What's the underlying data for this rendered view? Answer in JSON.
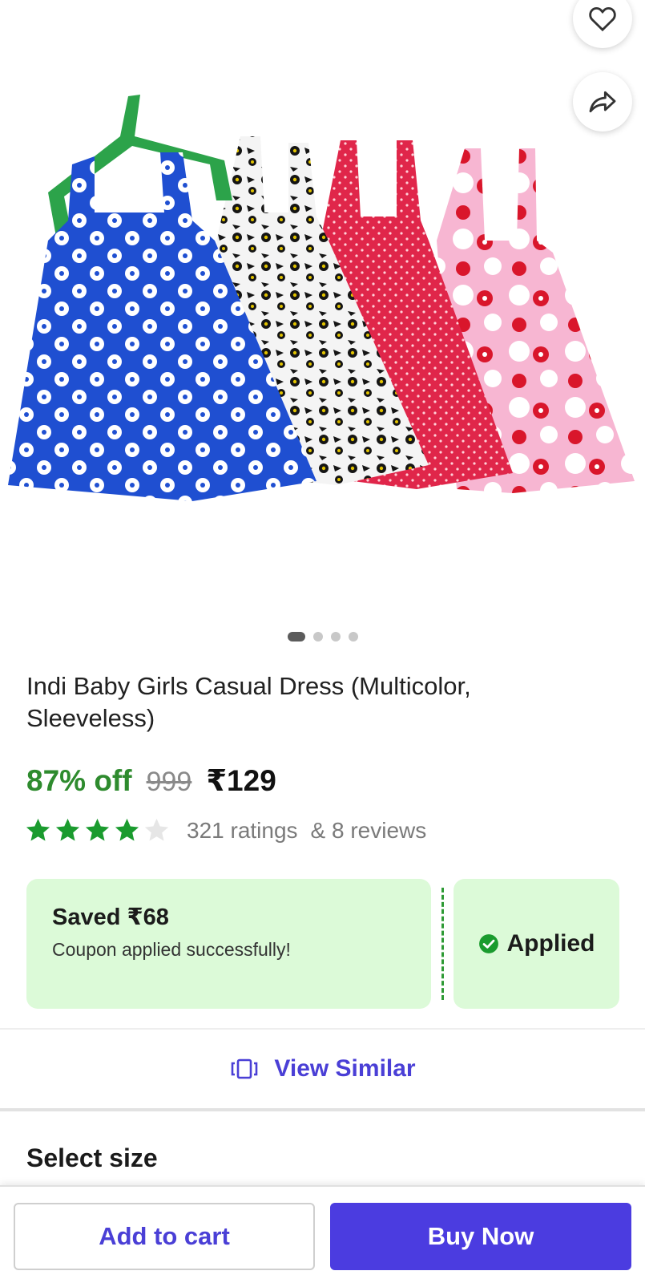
{
  "product": {
    "title": "Indi Baby Girls Casual Dress (Multicolor, Sleeveless)",
    "discount": "87% off",
    "mrp": "999",
    "price": "₹129",
    "rating_stars": 4,
    "ratings_text": "321 ratings",
    "reviews_text": "& 8 reviews",
    "image_count": 4,
    "active_image": 0
  },
  "coupon": {
    "saved": "Saved ₹68",
    "message": "Coupon applied successfully!",
    "status": "Applied"
  },
  "view_similar": {
    "label": "View Similar"
  },
  "size_section": {
    "heading": "Select size"
  },
  "actions": {
    "add_to_cart": "Add to cart",
    "buy_now": "Buy Now"
  },
  "icons": {
    "wishlist": "heart-icon",
    "share": "share-arrow-icon",
    "view_similar": "stacked-cards-icon",
    "applied": "check-circle-icon",
    "star": "star-icon"
  },
  "colors": {
    "accent": "#4b3ce0",
    "discount_green": "#2e8b2e",
    "star_green": "#1a9b2e",
    "coupon_bg": "#dcfad8"
  }
}
